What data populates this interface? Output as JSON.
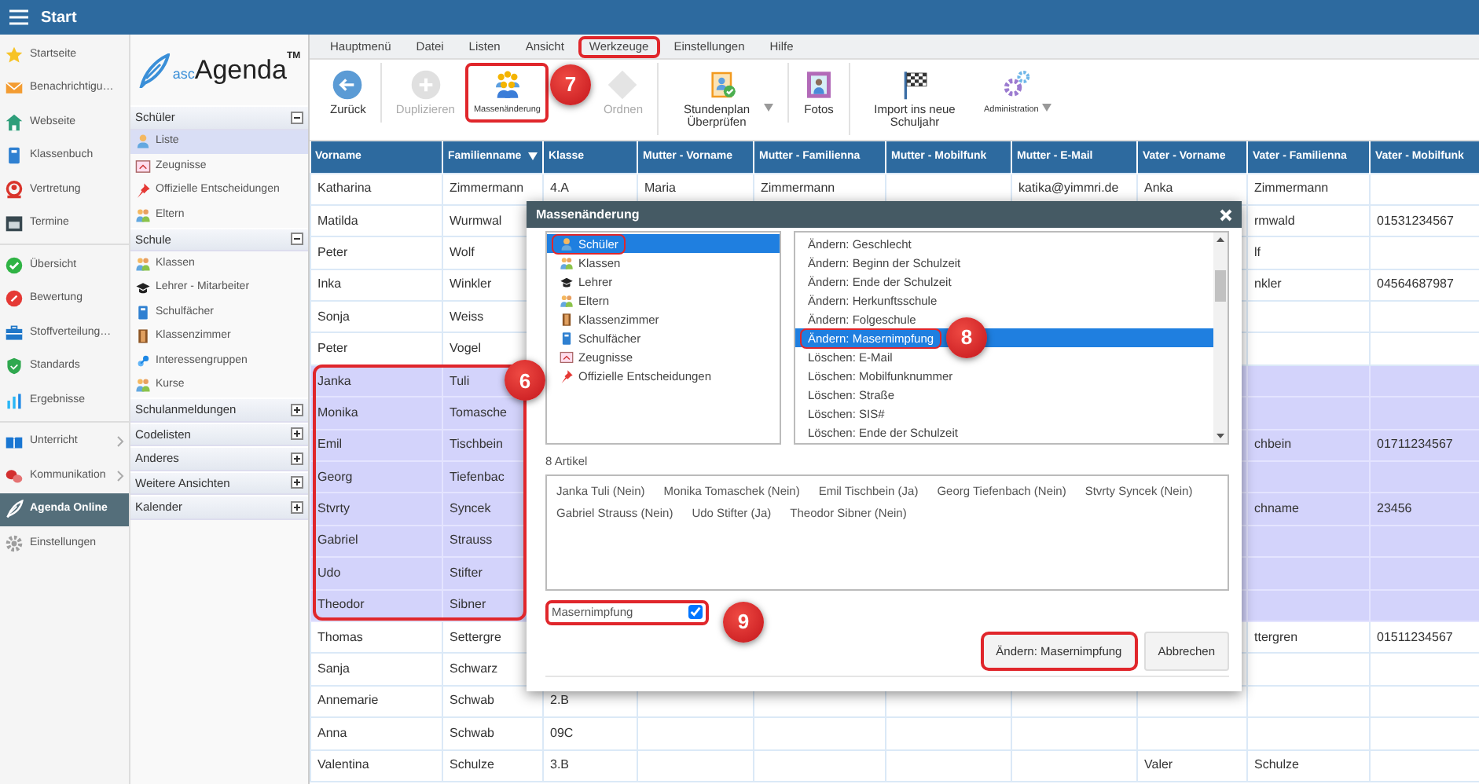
{
  "topbar": {
    "title": "Start"
  },
  "nav": {
    "groups": [
      {
        "items": [
          {
            "label": "Startseite",
            "selected": false
          },
          {
            "label": "Benachrichtigu…",
            "selected": false
          },
          {
            "label": "Webseite",
            "selected": false
          },
          {
            "label": "Klassenbuch",
            "selected": false
          },
          {
            "label": "Vertretung",
            "selected": false
          },
          {
            "label": "Termine",
            "selected": false
          }
        ]
      },
      {
        "items": [
          {
            "label": "Übersicht",
            "selected": false
          },
          {
            "label": "Bewertung",
            "selected": false
          },
          {
            "label": "Stoffverteilung…",
            "selected": false
          },
          {
            "label": "Standards",
            "selected": false
          },
          {
            "label": "Ergebnisse",
            "selected": false
          }
        ]
      },
      {
        "items": [
          {
            "label": "Unterricht",
            "selected": false,
            "submenu": true
          },
          {
            "label": "Kommunikation",
            "selected": false,
            "submenu": true
          },
          {
            "label": "Agenda Online",
            "selected": true
          },
          {
            "label": "Einstellungen",
            "selected": false
          }
        ]
      }
    ]
  },
  "logo": {
    "prefix": "asc",
    "name": "Agenda",
    "mark": "TM"
  },
  "sidebar": {
    "sections": [
      {
        "title": "Schüler",
        "expanded": true,
        "items": [
          {
            "label": "Liste",
            "selected": true
          },
          {
            "label": "Zeugnisse",
            "selected": false
          },
          {
            "label": "Offizielle Entscheidungen",
            "selected": false
          },
          {
            "label": "Eltern",
            "selected": false
          }
        ]
      },
      {
        "title": "Schule",
        "expanded": true,
        "items": [
          {
            "label": "Klassen",
            "selected": false
          },
          {
            "label": "Lehrer - Mitarbeiter",
            "selected": false
          },
          {
            "label": "Schulfächer",
            "selected": false
          },
          {
            "label": "Klassenzimmer",
            "selected": false
          },
          {
            "label": "Interessengruppen",
            "selected": false
          },
          {
            "label": "Kurse",
            "selected": false
          }
        ]
      },
      {
        "title": "Schulanmeldungen",
        "expanded": false
      },
      {
        "title": "Codelisten",
        "expanded": false
      },
      {
        "title": "Anderes",
        "expanded": false
      },
      {
        "title": "Weitere Ansichten",
        "expanded": false
      },
      {
        "title": "Kalender",
        "expanded": false
      }
    ]
  },
  "menu": [
    {
      "label": "Hauptmenü",
      "highlighted": false
    },
    {
      "label": "Datei",
      "highlighted": false
    },
    {
      "label": "Listen",
      "highlighted": false
    },
    {
      "label": "Ansicht",
      "highlighted": false
    },
    {
      "label": "Werkzeuge",
      "highlighted": true
    },
    {
      "label": "Einstellungen",
      "highlighted": false
    },
    {
      "label": "Hilfe",
      "highlighted": false
    }
  ],
  "toolbar": {
    "groups": [
      {
        "buttons": [
          {
            "label": "Zurück",
            "disabled": false,
            "highlighted": false
          }
        ]
      },
      {
        "buttons": [
          {
            "label": "Duplizieren",
            "disabled": true,
            "highlighted": false
          },
          {
            "label": "Massenänderung",
            "disabled": false,
            "highlighted": true
          },
          {
            "label": "Ordnen",
            "disabled": true,
            "highlighted": false
          }
        ]
      },
      {
        "buttons": [
          {
            "label": "Stundenplan Überprüfen",
            "disabled": false,
            "highlighted": false,
            "dropdown": true
          }
        ]
      },
      {
        "buttons": [
          {
            "label": "Fotos",
            "disabled": false,
            "highlighted": false
          }
        ]
      },
      {
        "buttons": [
          {
            "label": "Import ins neue Schuljahr",
            "disabled": false,
            "highlighted": false
          },
          {
            "label": "Administration",
            "disabled": false,
            "highlighted": false,
            "dropdown": true
          }
        ]
      }
    ]
  },
  "table": {
    "selection_highlighted": true,
    "columns": [
      {
        "label": "Vorname",
        "sorted": false
      },
      {
        "label": "Familienname",
        "sorted": true
      },
      {
        "label": "Klasse",
        "sorted": false
      },
      {
        "label": "Mutter - Vorname",
        "sorted": false
      },
      {
        "label": "Mutter - Familienna",
        "sorted": false
      },
      {
        "label": "Mutter - Mobilfunk",
        "sorted": false
      },
      {
        "label": "Mutter - E-Mail",
        "sorted": false
      },
      {
        "label": "Vater - Vorname",
        "sorted": false
      },
      {
        "label": "Vater - Familienna",
        "sorted": false
      },
      {
        "label": "Vater - Mobilfunk",
        "sorted": false
      }
    ],
    "rows": [
      {
        "selected": false,
        "vorname": "Katharina",
        "familienname": "Zimmermann",
        "klasse": "4.A",
        "mutter_vorname": "Maria",
        "mutter_familienname": "Zimmermann",
        "mutter_email": "katika@yimmri.de",
        "vater_vorname": "Anka",
        "vater_familienname": "Zimmermann"
      },
      {
        "selected": false,
        "vorname": "Matilda",
        "familienname": "Wurmwal",
        "vater_familienname": "rmwald",
        "vater_mobil": "01531234567"
      },
      {
        "selected": false,
        "vorname": "Peter",
        "familienname": "Wolf",
        "vater_familienname": "lf"
      },
      {
        "selected": false,
        "vorname": "Inka",
        "familienname": "Winkler",
        "vater_familienname": "nkler",
        "vater_mobil": "04564687987"
      },
      {
        "selected": false,
        "vorname": "Sonja",
        "familienname": "Weiss"
      },
      {
        "selected": false,
        "vorname": "Peter",
        "familienname": "Vogel"
      },
      {
        "selected": true,
        "vorname": "Janka",
        "familienname": "Tuli"
      },
      {
        "selected": true,
        "vorname": "Monika",
        "familienname": "Tomasche"
      },
      {
        "selected": true,
        "vorname": "Emil",
        "familienname": "Tischbein",
        "vater_familienname": "chbein",
        "vater_mobil": "01711234567"
      },
      {
        "selected": true,
        "vorname": "Georg",
        "familienname": "Tiefenbac"
      },
      {
        "selected": true,
        "vorname": "Stvrty",
        "familienname": "Syncek",
        "vater_familienname": "chname",
        "vater_mobil": "23456"
      },
      {
        "selected": true,
        "vorname": "Gabriel",
        "familienname": "Strauss"
      },
      {
        "selected": true,
        "vorname": "Udo",
        "familienname": "Stifter"
      },
      {
        "selected": true,
        "vorname": "Theodor",
        "familienname": "Sibner"
      },
      {
        "selected": false,
        "vorname": "Thomas",
        "familienname": "Settergre",
        "vater_familienname": "ttergren",
        "vater_mobil": "01511234567"
      },
      {
        "selected": false,
        "vorname": "Sanja",
        "familienname": "Schwarz"
      },
      {
        "selected": false,
        "vorname": "Annemarie",
        "familienname": "Schwab",
        "klasse": "2.B"
      },
      {
        "selected": false,
        "vorname": "Anna",
        "familienname": "Schwab",
        "klasse": "09C"
      },
      {
        "selected": false,
        "vorname": "Valentina",
        "familienname": "Schulze",
        "klasse": "3.B",
        "vater_vorname": "Valer",
        "vater_familienname": "Schulze"
      }
    ]
  },
  "dialog": {
    "title": "Massenänderung",
    "entities": [
      {
        "label": "Schüler",
        "selected": true,
        "highlighted": true
      },
      {
        "label": "Klassen",
        "selected": false,
        "highlighted": false
      },
      {
        "label": "Lehrer",
        "selected": false,
        "highlighted": false
      },
      {
        "label": "Eltern",
        "selected": false,
        "highlighted": false
      },
      {
        "label": "Klassenzimmer",
        "selected": false,
        "highlighted": false
      },
      {
        "label": "Schulfächer",
        "selected": false,
        "highlighted": false
      },
      {
        "label": "Zeugnisse",
        "selected": false,
        "highlighted": false
      },
      {
        "label": "Offizielle Entscheidungen",
        "selected": false,
        "highlighted": false
      }
    ],
    "actions": [
      {
        "label": "Ändern: Geschlecht",
        "selected": false,
        "highlighted": false
      },
      {
        "label": "Ändern: Beginn der Schulzeit",
        "selected": false,
        "highlighted": false
      },
      {
        "label": "Ändern: Ende der Schulzeit",
        "selected": false,
        "highlighted": false
      },
      {
        "label": "Ändern: Herkunftsschule",
        "selected": false,
        "highlighted": false
      },
      {
        "label": "Ändern: Folgeschule",
        "selected": false,
        "highlighted": false
      },
      {
        "label": "Ändern: Masernimpfung",
        "selected": true,
        "highlighted": true
      },
      {
        "label": "Löschen: E-Mail",
        "selected": false,
        "highlighted": false
      },
      {
        "label": "Löschen: Mobilfunknummer",
        "selected": false,
        "highlighted": false
      },
      {
        "label": "Löschen: Straße",
        "selected": false,
        "highlighted": false
      },
      {
        "label": "Löschen: SIS#",
        "selected": false,
        "highlighted": false
      },
      {
        "label": "Löschen: Ende der Schulzeit",
        "selected": false,
        "highlighted": false
      }
    ],
    "count": "8 Artikel",
    "items": [
      "Janka Tuli (Nein)",
      "Monika Tomaschek (Nein)",
      "Emil Tischbein (Ja)",
      "Georg Tiefenbach (Nein)",
      "Stvrty Syncek (Nein)",
      "Gabriel Strauss (Nein)",
      "Udo Stifter (Ja)",
      "Theodor Sibner (Nein)"
    ],
    "checkbox": {
      "label": "Masernimpfung",
      "checked": true,
      "highlighted": true
    },
    "buttons": [
      {
        "label": "Ändern: Masernimpfung",
        "highlighted": true
      },
      {
        "label": "Abbrechen",
        "highlighted": false
      }
    ]
  },
  "annotations": [
    {
      "label": "6"
    },
    {
      "label": "7"
    },
    {
      "label": "8"
    },
    {
      "label": "9"
    }
  ]
}
